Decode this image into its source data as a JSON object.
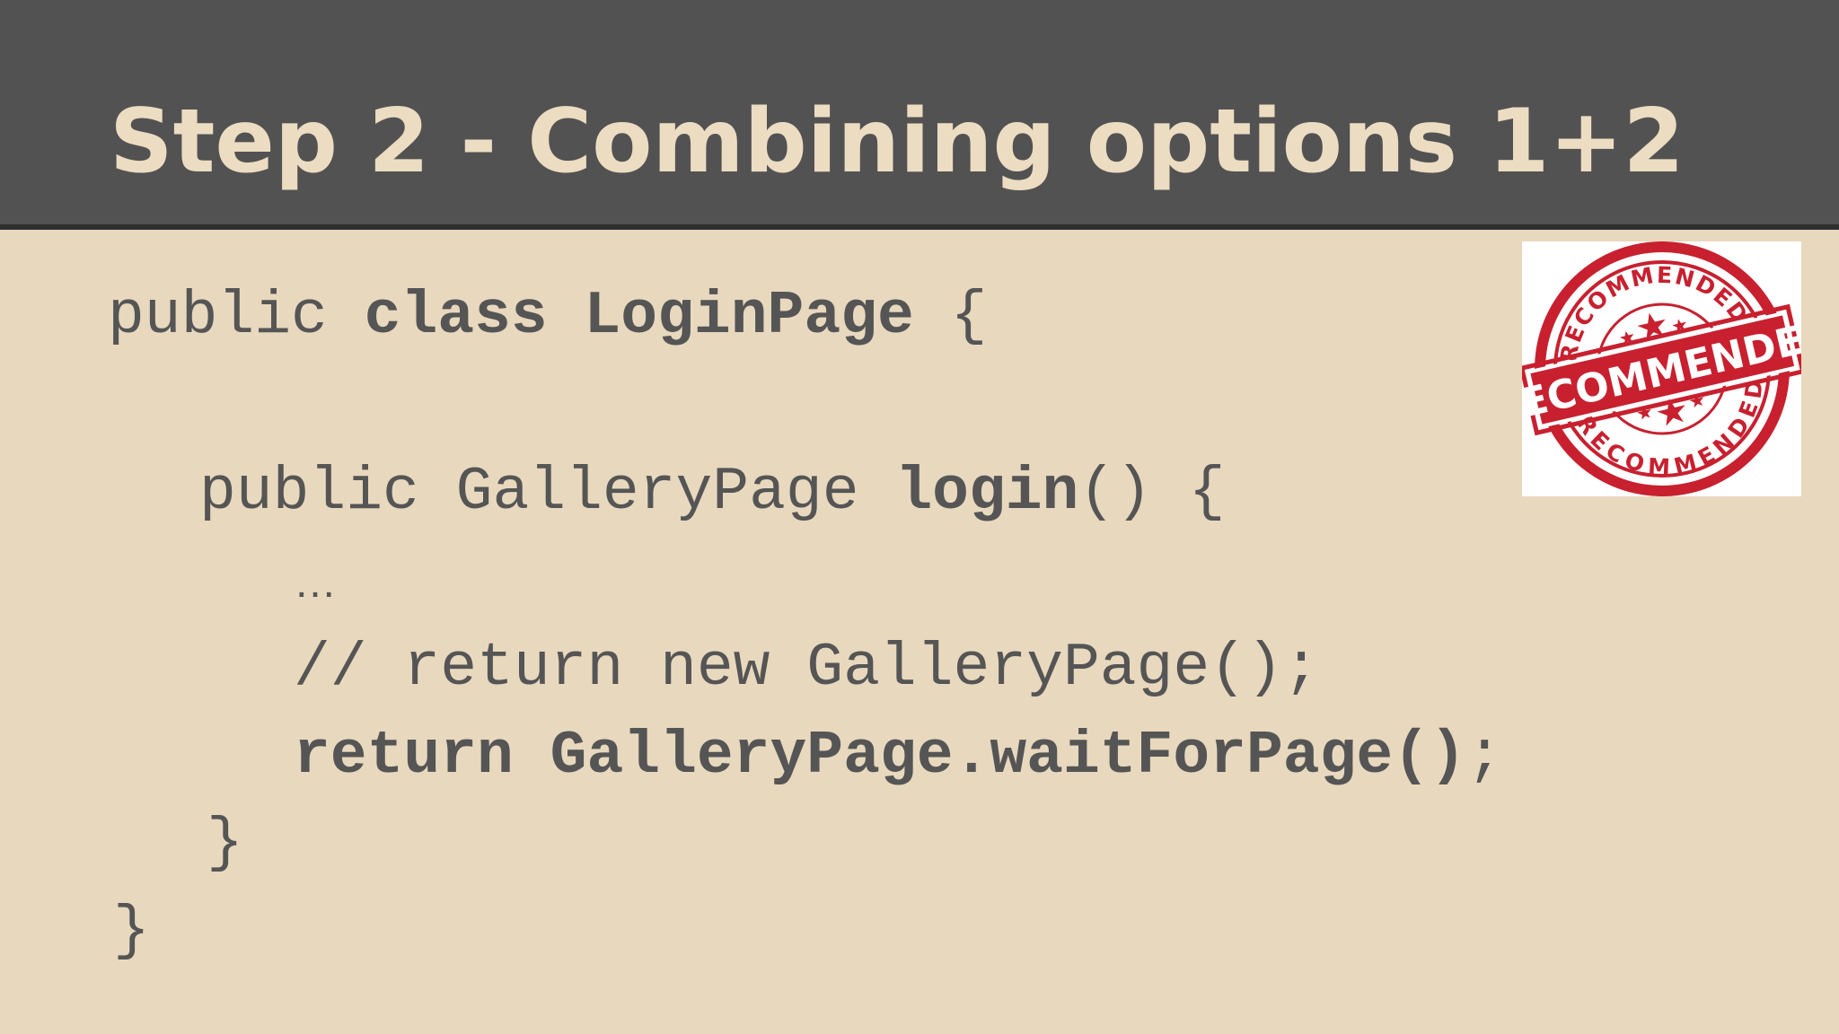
{
  "slide": {
    "title": "Step 2 - Combining options 1+2"
  },
  "code": {
    "l1_a": "public ",
    "l1_b": "class LoginPage",
    "l1_c": " {",
    "l2_a": "public GalleryPage ",
    "l2_b": "login",
    "l2_c": "() {",
    "l3": "…",
    "l4": "// return new GalleryPage();",
    "l5_a": "return GalleryPage.waitForPage()",
    "l5_b": ";",
    "l6": "}",
    "l7": "}"
  },
  "stamp": {
    "main_text": "RECOMMENDED",
    "ring_top_text": "RECOMMENDED",
    "ring_bottom_text": "RECOMMENDED",
    "colors": {
      "red": "#c8202f",
      "white": "#ffffff"
    }
  },
  "colors": {
    "background": "#e8d8be",
    "header": "#525252",
    "title": "#ecdcc2",
    "code_text": "#555555"
  }
}
